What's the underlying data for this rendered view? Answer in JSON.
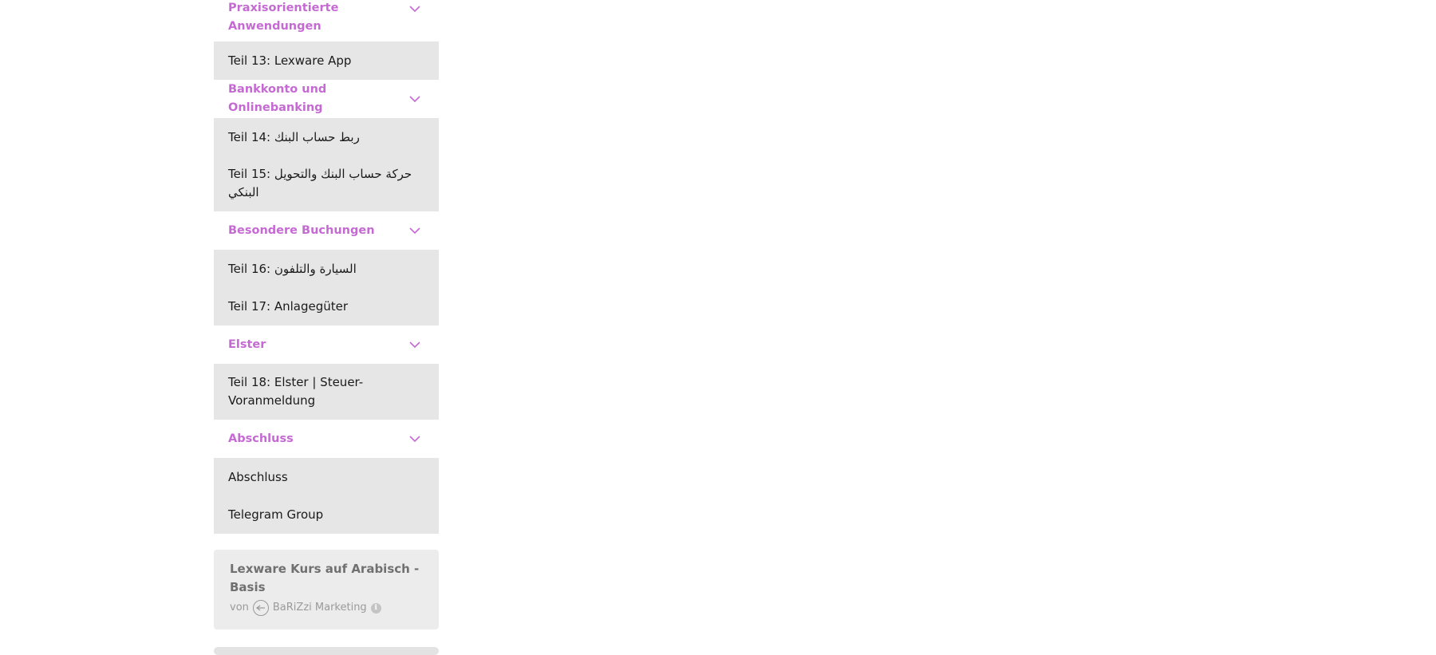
{
  "sections": [
    {
      "title": "Praxisorientierte Anwendungen"
    },
    {
      "title": "Bankkonto und Onlinebanking"
    },
    {
      "title": "Besondere Buchungen"
    },
    {
      "title": "Elster"
    },
    {
      "title": "Abschluss"
    }
  ],
  "lessons": {
    "teil13": "Teil 13: Lexware App",
    "teil14": "Teil 14: ربط حساب البنك",
    "teil15": "Teil 15: حركة حساب البنك والتحويل البنكي",
    "teil16": "Teil 16: السيارة والتلفون",
    "teil17": "Teil 17: Anlagegüter",
    "teil18": "Teil 18: Elster | Steuer-Voranmeldung",
    "abschluss": "Abschluss",
    "telegram": "Telegram Group"
  },
  "course_card": {
    "title": "Lexware Kurs auf Arabisch - Basis",
    "by_label": "von",
    "author": "BaRiZzi Marketing"
  },
  "colors": {
    "accent": "#c56ad3",
    "group_bg": "#e6e6e6",
    "card_bg": "#ececec"
  },
  "icons": {
    "chevron": "chevron-down-icon",
    "info": "info-icon",
    "avatar": "author-avatar"
  }
}
